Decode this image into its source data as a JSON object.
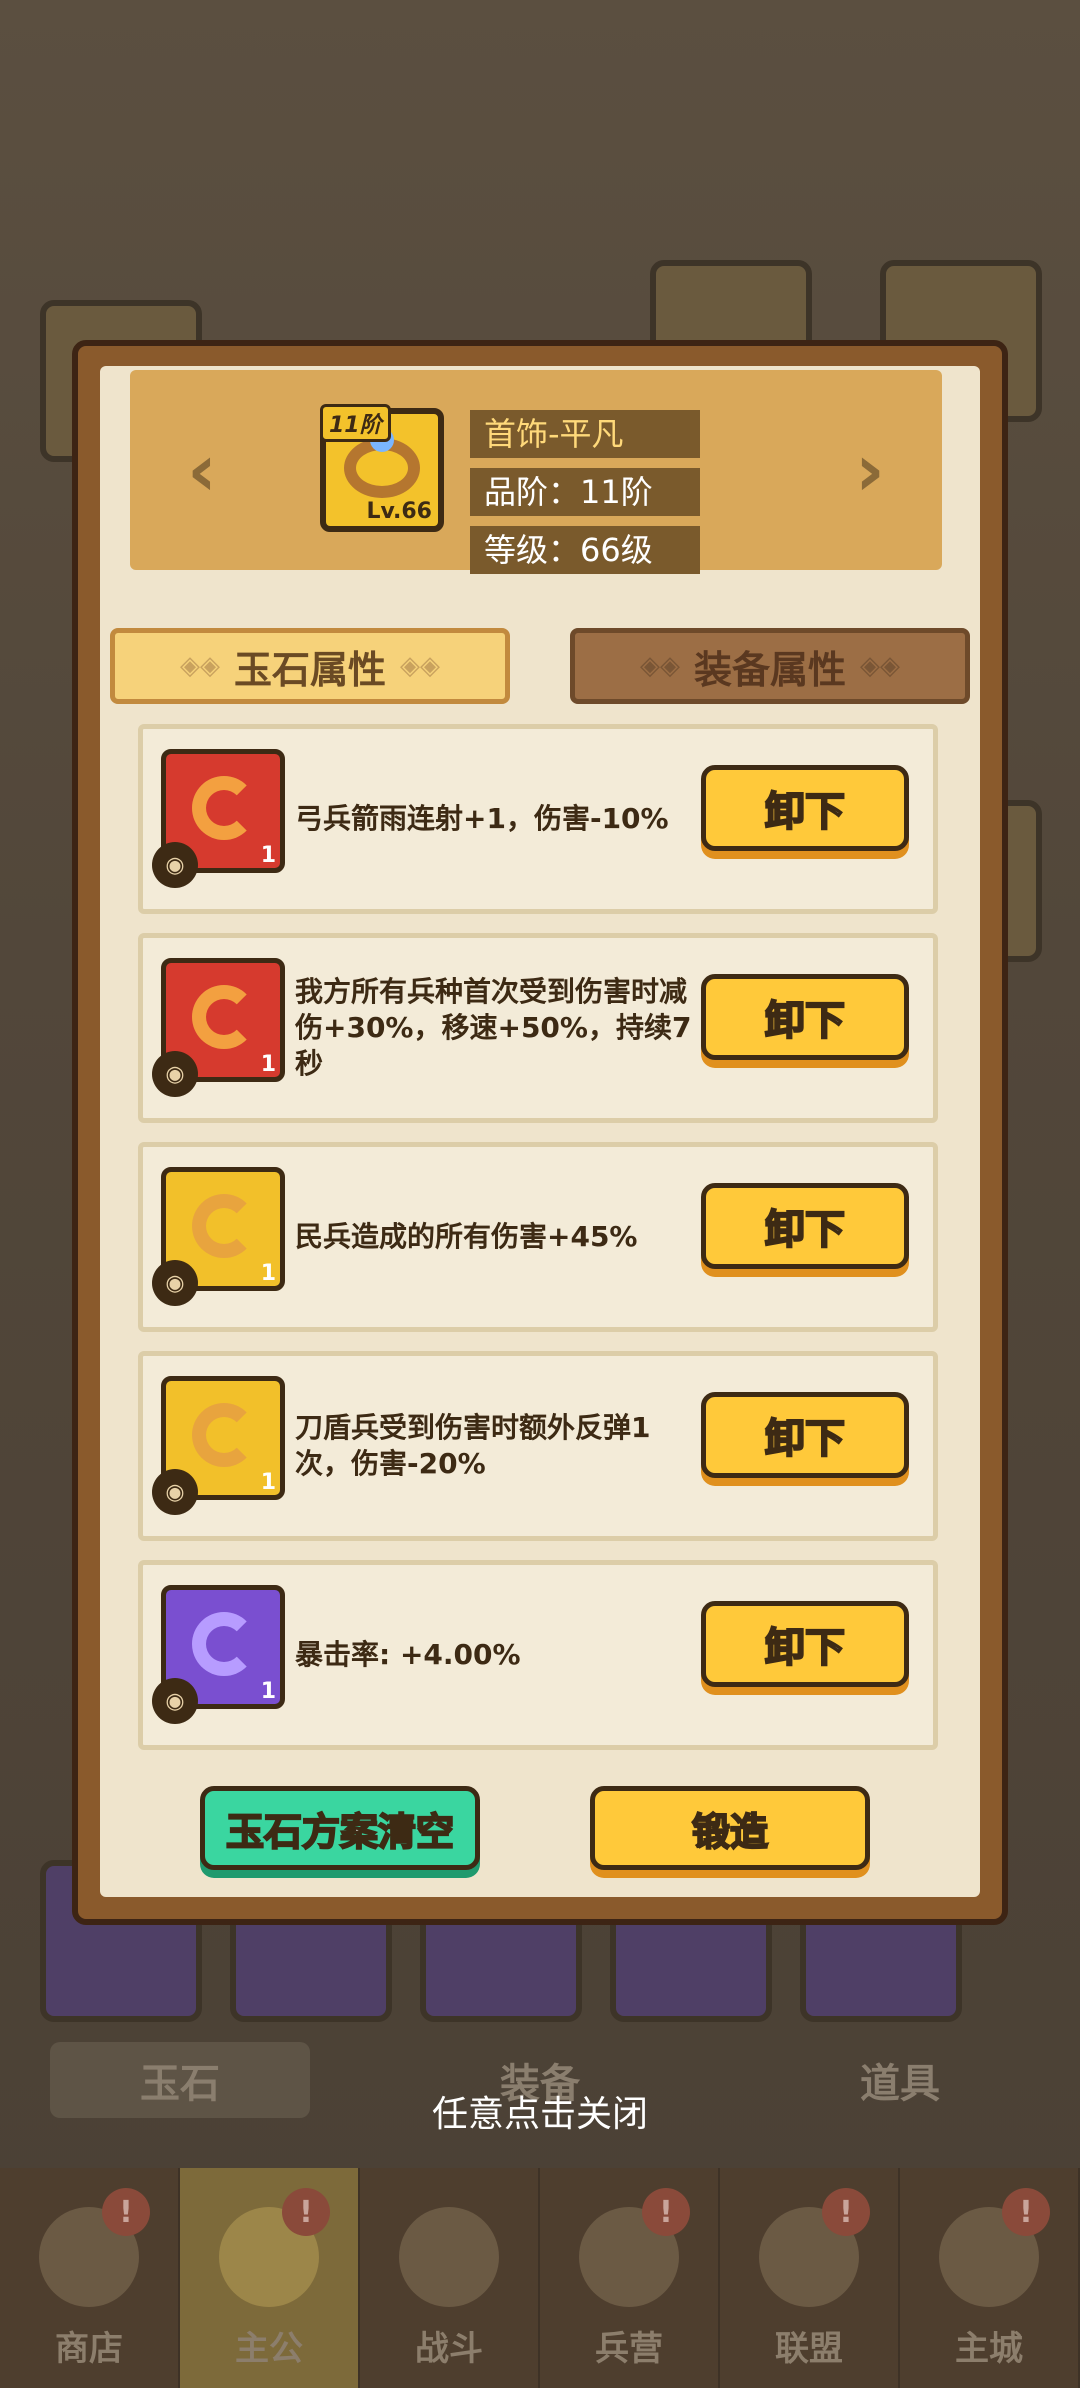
{
  "background": {
    "tabs": [
      "玉石",
      "装备",
      "道具"
    ],
    "nav": [
      {
        "label": "商店",
        "badge": "!"
      },
      {
        "label": "主公",
        "badge": "!"
      },
      {
        "label": "战斗",
        "badge": ""
      },
      {
        "label": "兵营",
        "badge": "!"
      },
      {
        "label": "联盟",
        "badge": "!"
      },
      {
        "label": "主城",
        "badge": "!"
      }
    ]
  },
  "header": {
    "item_tier": "11阶",
    "item_level": "Lv.66",
    "name": "首饰-平凡",
    "grade": "品阶：11阶",
    "level": "等级：66级"
  },
  "tabs": {
    "jade_attr": "玉石属性",
    "equip_attr": "装备属性"
  },
  "jade_rows": [
    {
      "color": "red",
      "count": "1",
      "desc": "弓兵箭雨连射+1，伤害-10%",
      "button": "卸下"
    },
    {
      "color": "red",
      "count": "1",
      "desc": "我方所有兵种首次受到伤害时减伤+30%，移速+50%，持续7秒",
      "button": "卸下"
    },
    {
      "color": "gold",
      "count": "1",
      "desc": "民兵造成的所有伤害+45%",
      "button": "卸下"
    },
    {
      "color": "gold",
      "count": "1",
      "desc": "刀盾兵受到伤害时额外反弹1次，伤害-20%",
      "button": "卸下"
    },
    {
      "color": "purple",
      "count": "1",
      "desc": "暴击率: +4.00%",
      "button": "卸下"
    }
  ],
  "buttons": {
    "clear": "玉石方案清空",
    "forge": "锻造"
  },
  "hint": "任意点击关闭"
}
